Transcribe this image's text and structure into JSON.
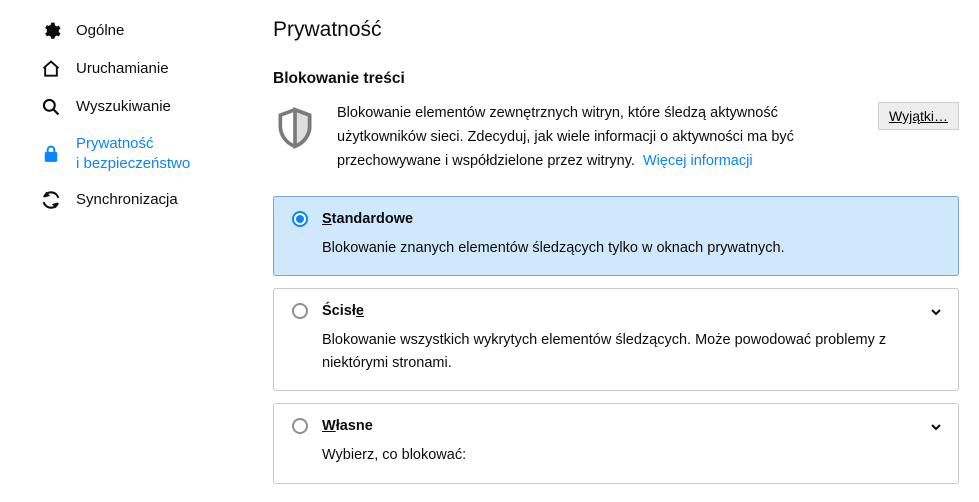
{
  "sidebar": {
    "items": [
      {
        "label": "Ogólne"
      },
      {
        "label": "Uruchamianie"
      },
      {
        "label": "Wyszukiwanie"
      },
      {
        "label": "Prywatność\ni bezpieczeństwo"
      },
      {
        "label": "Synchronizacja"
      }
    ]
  },
  "page": {
    "title": "Prywatność",
    "section_title": "Blokowanie treści",
    "description": "Blokowanie elementów zewnętrznych witryn, które śledzą aktywność użytkowników sieci. Zdecyduj, jak wiele informacji o aktywności ma być przechowywane i współdzielone przez witryny.",
    "more_info": "Więcej informacji",
    "exceptions_btn": "Wyjątki…"
  },
  "options": {
    "standard": {
      "title_u": "S",
      "title_rest": "tandardowe",
      "desc": "Blokowanie znanych elementów śledzących tylko w oknach prywatnych."
    },
    "strict": {
      "title_pre": "Ścisł",
      "title_u": "e",
      "desc": "Blokowanie wszystkich wykrytych elementów śledzących. Może powodować problemy z niektórymi stronami."
    },
    "custom": {
      "title_u": "W",
      "title_rest": "łasne",
      "desc": "Wybierz, co blokować:"
    }
  }
}
